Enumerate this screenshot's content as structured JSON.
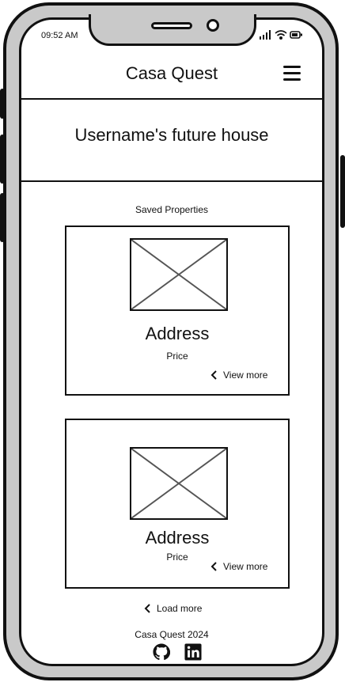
{
  "status_bar": {
    "time": "09:52 AM"
  },
  "header": {
    "title": "Casa Quest"
  },
  "hero": {
    "title": "Username's future house"
  },
  "saved": {
    "label": "Saved Properties",
    "cards": [
      {
        "address": "Address",
        "price": "Price",
        "view_more": "View more"
      },
      {
        "address": "Address",
        "price": "Price",
        "view_more": "View more"
      }
    ],
    "load_more": "Load more"
  },
  "footer": {
    "text": "Casa Quest 2024"
  },
  "icons": {
    "menu": "hamburger-icon",
    "image": "image-placeholder-icon",
    "chevron": "chevron-left-icon",
    "github": "github-icon",
    "linkedin": "linkedin-icon"
  }
}
